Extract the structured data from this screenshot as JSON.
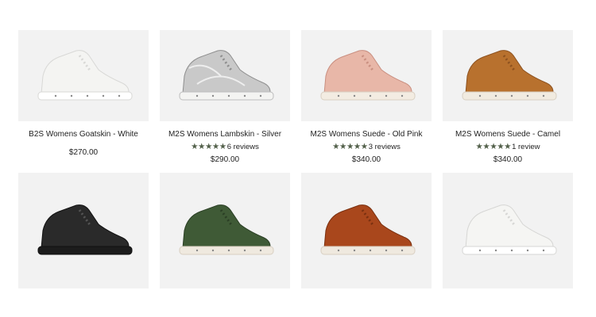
{
  "products": [
    {
      "title": "B2S Womens Goatskin - White",
      "stars": "",
      "reviews": "",
      "price": "$270.00",
      "color": "#f4f4f2",
      "sole": "#ffffff",
      "accent": "#d8d8d6"
    },
    {
      "title": "M2S Womens Lambskin - Silver",
      "stars": "★★★★★",
      "reviews": "6 reviews",
      "price": "$290.00",
      "color": "#c9c9c9",
      "sole": "#f4f4f2",
      "accent": "#8e8e8e"
    },
    {
      "title": "M2S Womens Suede - Old Pink",
      "stars": "★★★★★",
      "reviews": "3 reviews",
      "price": "$340.00",
      "color": "#e8b7a8",
      "sole": "#f3ece2",
      "accent": "#c98f80"
    },
    {
      "title": "M2S Womens Suede - Camel",
      "stars": "★★★★★",
      "reviews": "1 review",
      "price": "$340.00",
      "color": "#b8712e",
      "sole": "#f1ebe0",
      "accent": "#8d5220"
    },
    {
      "title": "",
      "stars": "",
      "reviews": "",
      "price": "",
      "color": "#2a2a2a",
      "sole": "#1c1c1c",
      "accent": "#111111"
    },
    {
      "title": "",
      "stars": "",
      "reviews": "",
      "price": "",
      "color": "#3f5a36",
      "sole": "#efe9df",
      "accent": "#2b3f25"
    },
    {
      "title": "",
      "stars": "",
      "reviews": "",
      "price": "",
      "color": "#a9471c",
      "sole": "#efe9df",
      "accent": "#7a3010"
    },
    {
      "title": "",
      "stars": "",
      "reviews": "",
      "price": "",
      "color": "#f5f5f3",
      "sole": "#ffffff",
      "accent": "#d6d6d4"
    }
  ]
}
